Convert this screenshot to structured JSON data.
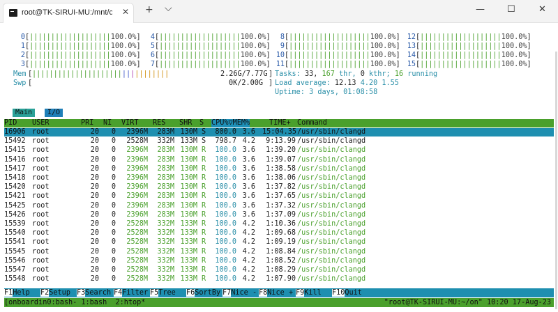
{
  "window": {
    "tab_title": "root@TK-SIRUI-MU:/mnt/c/Use",
    "close_glyph": "✕",
    "new_tab_glyph": "+",
    "dropdown_glyph": "⌵",
    "minimize_glyph": "—",
    "maximize_glyph": "☐",
    "close_window_glyph": "✕"
  },
  "cpu_meters": [
    {
      "id": "0",
      "pct": "100.0%"
    },
    {
      "id": "1",
      "pct": "100.0%"
    },
    {
      "id": "2",
      "pct": "100.0%"
    },
    {
      "id": "3",
      "pct": "100.0%"
    },
    {
      "id": "4",
      "pct": "100.0%"
    },
    {
      "id": "5",
      "pct": "100.0%"
    },
    {
      "id": "6",
      "pct": "100.0%"
    },
    {
      "id": "7",
      "pct": "100.0%"
    },
    {
      "id": "8",
      "pct": "100.0%"
    },
    {
      "id": "9",
      "pct": "100.0%"
    },
    {
      "id": "10",
      "pct": "100.0%"
    },
    {
      "id": "11",
      "pct": "100.0%"
    },
    {
      "id": "12",
      "pct": "100.0%"
    },
    {
      "id": "13",
      "pct": "100.0%"
    },
    {
      "id": "14",
      "pct": "100.0%"
    },
    {
      "id": "15",
      "pct": "100.0%"
    }
  ],
  "memory": {
    "label": "Mem",
    "value": "2.26G/7.77G"
  },
  "swap": {
    "label": "Swp",
    "value": "0K/2.00G"
  },
  "tasks": {
    "label": "Tasks:",
    "count": "33,",
    "thr": "167",
    "thr_label": "thr,",
    "kthr": "0",
    "kthr_label": "kthr;",
    "running": "16",
    "running_label": "running"
  },
  "load": {
    "label": "Load average:",
    "v1": "12.13",
    "v2": "4.20",
    "v3": "1.55"
  },
  "uptime": {
    "label": "Uptime:",
    "value": "3 days, 01:08:58"
  },
  "subtabs": {
    "main": "Main",
    "io": "I/O"
  },
  "columns": [
    "PID",
    "USER",
    "PRI",
    "NI",
    "VIRT",
    "RES",
    "SHR",
    "S",
    "CPU%▽MEM%",
    "TIME+",
    "Command"
  ],
  "processes": [
    {
      "pid": "16906",
      "user": "root",
      "pri": "20",
      "ni": "0",
      "virt": "2396M",
      "res": "283M",
      "shr": "130M",
      "s": "S",
      "cpu": "800.0",
      "mem": "3.6",
      "time": "15:04.35",
      "cmd": "/usr/sbin/clangd"
    },
    {
      "pid": "15492",
      "user": "root",
      "pri": "20",
      "ni": "0",
      "virt": "2528M",
      "res": "332M",
      "shr": "133M",
      "s": "S",
      "cpu": "798.7",
      "mem": "4.2",
      "time": "9:13.99",
      "cmd": "/usr/sbin/clangd"
    },
    {
      "pid": "15415",
      "user": "root",
      "pri": "20",
      "ni": "0",
      "virt": "2396M",
      "res": "283M",
      "shr": "130M",
      "s": "R",
      "cpu": "100.0",
      "mem": "3.6",
      "time": "1:39.20",
      "cmd": "/usr/sbin/clangd"
    },
    {
      "pid": "15416",
      "user": "root",
      "pri": "20",
      "ni": "0",
      "virt": "2396M",
      "res": "283M",
      "shr": "130M",
      "s": "R",
      "cpu": "100.0",
      "mem": "3.6",
      "time": "1:39.07",
      "cmd": "/usr/sbin/clangd"
    },
    {
      "pid": "15417",
      "user": "root",
      "pri": "20",
      "ni": "0",
      "virt": "2396M",
      "res": "283M",
      "shr": "130M",
      "s": "R",
      "cpu": "100.0",
      "mem": "3.6",
      "time": "1:38.58",
      "cmd": "/usr/sbin/clangd"
    },
    {
      "pid": "15418",
      "user": "root",
      "pri": "20",
      "ni": "0",
      "virt": "2396M",
      "res": "283M",
      "shr": "130M",
      "s": "R",
      "cpu": "100.0",
      "mem": "3.6",
      "time": "1:38.06",
      "cmd": "/usr/sbin/clangd"
    },
    {
      "pid": "15420",
      "user": "root",
      "pri": "20",
      "ni": "0",
      "virt": "2396M",
      "res": "283M",
      "shr": "130M",
      "s": "R",
      "cpu": "100.0",
      "mem": "3.6",
      "time": "1:37.82",
      "cmd": "/usr/sbin/clangd"
    },
    {
      "pid": "15421",
      "user": "root",
      "pri": "20",
      "ni": "0",
      "virt": "2396M",
      "res": "283M",
      "shr": "130M",
      "s": "R",
      "cpu": "100.0",
      "mem": "3.6",
      "time": "1:37.65",
      "cmd": "/usr/sbin/clangd"
    },
    {
      "pid": "15425",
      "user": "root",
      "pri": "20",
      "ni": "0",
      "virt": "2396M",
      "res": "283M",
      "shr": "130M",
      "s": "R",
      "cpu": "100.0",
      "mem": "3.6",
      "time": "1:37.32",
      "cmd": "/usr/sbin/clangd"
    },
    {
      "pid": "15426",
      "user": "root",
      "pri": "20",
      "ni": "0",
      "virt": "2396M",
      "res": "283M",
      "shr": "130M",
      "s": "R",
      "cpu": "100.0",
      "mem": "3.6",
      "time": "1:37.09",
      "cmd": "/usr/sbin/clangd"
    },
    {
      "pid": "15539",
      "user": "root",
      "pri": "20",
      "ni": "0",
      "virt": "2528M",
      "res": "332M",
      "shr": "133M",
      "s": "R",
      "cpu": "100.0",
      "mem": "4.2",
      "time": "1:10.36",
      "cmd": "/usr/sbin/clangd"
    },
    {
      "pid": "15540",
      "user": "root",
      "pri": "20",
      "ni": "0",
      "virt": "2528M",
      "res": "332M",
      "shr": "133M",
      "s": "R",
      "cpu": "100.0",
      "mem": "4.2",
      "time": "1:09.68",
      "cmd": "/usr/sbin/clangd"
    },
    {
      "pid": "15541",
      "user": "root",
      "pri": "20",
      "ni": "0",
      "virt": "2528M",
      "res": "332M",
      "shr": "133M",
      "s": "R",
      "cpu": "100.0",
      "mem": "4.2",
      "time": "1:09.19",
      "cmd": "/usr/sbin/clangd"
    },
    {
      "pid": "15545",
      "user": "root",
      "pri": "20",
      "ni": "0",
      "virt": "2528M",
      "res": "332M",
      "shr": "133M",
      "s": "R",
      "cpu": "100.0",
      "mem": "4.2",
      "time": "1:08.84",
      "cmd": "/usr/sbin/clangd"
    },
    {
      "pid": "15546",
      "user": "root",
      "pri": "20",
      "ni": "0",
      "virt": "2528M",
      "res": "332M",
      "shr": "133M",
      "s": "R",
      "cpu": "100.0",
      "mem": "4.2",
      "time": "1:08.52",
      "cmd": "/usr/sbin/clangd"
    },
    {
      "pid": "15547",
      "user": "root",
      "pri": "20",
      "ni": "0",
      "virt": "2528M",
      "res": "332M",
      "shr": "133M",
      "s": "R",
      "cpu": "100.0",
      "mem": "4.2",
      "time": "1:08.29",
      "cmd": "/usr/sbin/clangd"
    },
    {
      "pid": "15548",
      "user": "root",
      "pri": "20",
      "ni": "0",
      "virt": "2528M",
      "res": "332M",
      "shr": "133M",
      "s": "R",
      "cpu": "100.0",
      "mem": "4.2",
      "time": "1:07.90",
      "cmd": "/usr/sbin/clangd"
    }
  ],
  "function_keys": [
    {
      "key": "F1",
      "label": "Help"
    },
    {
      "key": "F2",
      "label": "Setup"
    },
    {
      "key": "F3",
      "label": "Search"
    },
    {
      "key": "F4",
      "label": "Filter"
    },
    {
      "key": "F5",
      "label": "Tree"
    },
    {
      "key": "F6",
      "label": "SortBy"
    },
    {
      "key": "F7",
      "label": "Nice -"
    },
    {
      "key": "F8",
      "label": "Nice +"
    },
    {
      "key": "F9",
      "label": "Kill"
    },
    {
      "key": "F10",
      "label": "Quit"
    }
  ],
  "tmux": {
    "left": "[onboardin0:bash- 1:bash  2:htop*",
    "right": "\"root@TK-SIRUI-MU:~/on\" 10:20 17-Aug-23"
  },
  "colors": {
    "green": "#4aa02c",
    "cyan": "#1e8fb0",
    "teal": "#2aa198",
    "blue_num": "#2a5aa8"
  }
}
